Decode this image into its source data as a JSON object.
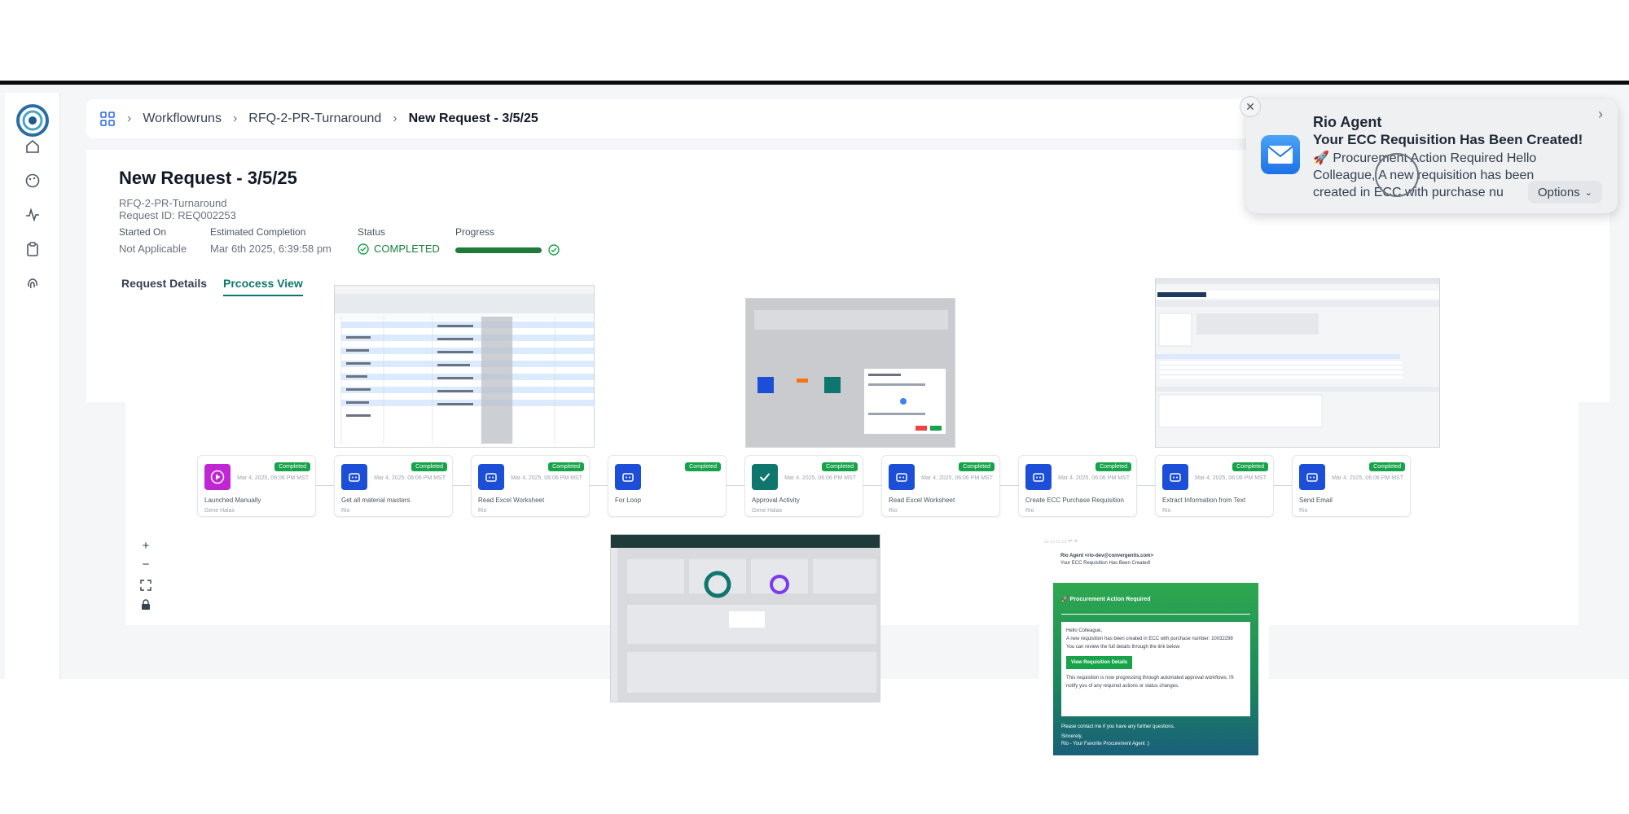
{
  "breadcrumb": {
    "items": [
      "Workflowruns",
      "RFQ-2-PR-Turnaround"
    ],
    "current": "New Request - 3/5/25"
  },
  "request": {
    "title": "New Request - 3/5/25",
    "workflow": "RFQ-2-PR-Turnaround",
    "request_id": "Request ID: REQ002253",
    "started_on_label": "Started On",
    "started_on": "Not Applicable",
    "est_completion_label": "Estimated Completion",
    "est_completion": "Mar 6th 2025, 6:39:58 pm",
    "status_label": "Status",
    "status": "COMPLETED",
    "progress_label": "Progress",
    "progress": 1.0
  },
  "tabs": {
    "details": "Request Details",
    "process": "Prcocess View"
  },
  "nodes": [
    {
      "name": "Launched Manually",
      "user": "Gene Halas",
      "badge": "Completed",
      "date": "Mar 4, 2025, 06:06 PM MST",
      "color": "#c026d3"
    },
    {
      "name": "Get all material masters",
      "user": "Rio",
      "badge": "Completed",
      "date": "Mar 4, 2025, 06:06 PM MST",
      "color": "#1d4ed8"
    },
    {
      "name": "Read Excel Worksheet",
      "user": "Rio",
      "badge": "Completed",
      "date": "Mar 4, 2025, 06:06 PM MST",
      "color": "#1d4ed8"
    },
    {
      "name": "For Loop",
      "user": "",
      "badge": "Completed",
      "date": "",
      "color": "#1d4ed8"
    },
    {
      "name": "Approval Activity",
      "user": "Gene Halas",
      "badge": "Completed",
      "date": "Mar 4, 2025, 06:06 PM MST",
      "color": "#0f766e"
    },
    {
      "name": "Read Excel Worksheet",
      "user": "Rio",
      "badge": "Completed",
      "date": "Mar 4, 2025, 06:06 PM MST",
      "color": "#1d4ed8"
    },
    {
      "name": "Create ECC Purchase Requisition",
      "user": "Rio",
      "badge": "Completed",
      "date": "Mar 4, 2025, 06:06 PM MST",
      "color": "#1d4ed8"
    },
    {
      "name": "Extract Information from Text",
      "user": "Rio",
      "badge": "Completed",
      "date": "Mar 4, 2025, 06:06 PM MST",
      "color": "#1d4ed8"
    },
    {
      "name": "Send Email",
      "user": "Rio",
      "badge": "Completed",
      "date": "Mar 4, 2025, 06:06 PM MST",
      "color": "#1d4ed8"
    }
  ],
  "zoom": {
    "plus": "+",
    "minus": "−"
  },
  "notification": {
    "app": "Rio Agent",
    "title": "Your ECC Requisition Has Been Created!",
    "body": "🚀 Procurement Action Required Hello Colleague, A new requisition has been created in ECC with purchase nu",
    "options": "Options"
  },
  "email": {
    "sender": "Rio Agent <rio-dev@convergentis.com>",
    "subject": "Your ECC Requisition Has Been Created!",
    "heading": "🚀 Procurement Action Required",
    "greeting": "Hello Colleague,",
    "line1": "A new requisition has been created in ECC with purchase number: 10032298",
    "line2": "You can review the full details through the link below:",
    "button": "View Requisition Details",
    "line3": "This requisition is now progressing through automated approval workflows. I'll notify you of any required actions or status changes.",
    "contact": "Please contact me if you have any further questions.",
    "signoff": "Sincerely,",
    "signature": "Rio - Your Favorite Procurement Agent :)"
  }
}
